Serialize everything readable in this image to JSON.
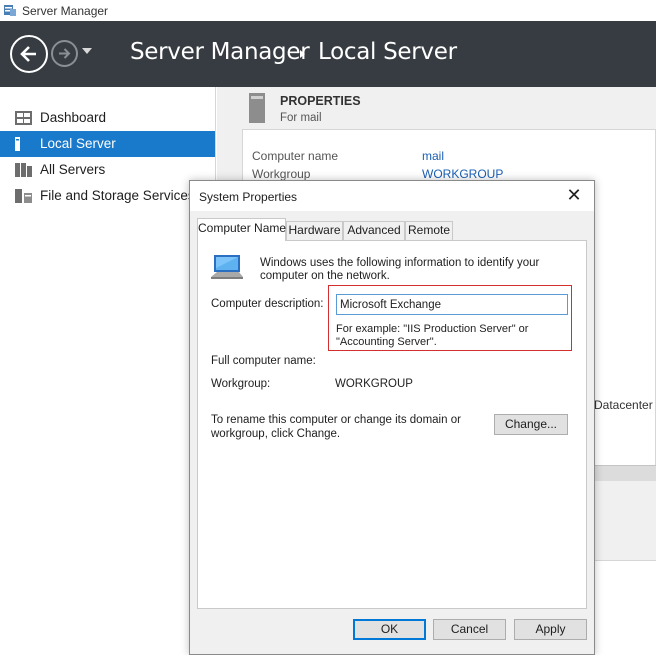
{
  "window": {
    "title": "Server Manager"
  },
  "header": {
    "breadcrumb": [
      "Server Manager",
      "Local Server"
    ]
  },
  "sidebar": {
    "items": [
      {
        "label": "Dashboard",
        "icon": "dashboard-icon",
        "active": false
      },
      {
        "label": "Local Server",
        "icon": "local-server-icon",
        "active": true
      },
      {
        "label": "All Servers",
        "icon": "all-servers-icon",
        "active": false
      },
      {
        "label": "File and Storage Services",
        "icon": "file-storage-icon",
        "active": false
      }
    ]
  },
  "properties": {
    "title": "PROPERTIES",
    "subtitle": "For mail",
    "rows": [
      {
        "label": "Computer name",
        "value": "mail"
      },
      {
        "label": "Workgroup",
        "value": "WORKGROUP"
      }
    ],
    "edition_fragment": "Datacenter"
  },
  "dialog": {
    "title": "System Properties",
    "close_glyph": "✕",
    "tabs": [
      "Computer Name",
      "Hardware",
      "Advanced",
      "Remote"
    ],
    "active_tab": "Computer Name",
    "intro": "Windows uses the following information to identify your computer on the network.",
    "description_label": "Computer description:",
    "description_value": "Microsoft Exchange",
    "example": "For example: \"IIS Production Server\" or \"Accounting Server\".",
    "full_name_label": "Full computer name:",
    "full_name_value": "",
    "workgroup_label": "Workgroup:",
    "workgroup_value": "WORKGROUP",
    "rename_text": "To rename this computer or change its domain or workgroup, click Change.",
    "change_button": "Change...",
    "ok_button": "OK",
    "cancel_button": "Cancel",
    "apply_button": "Apply"
  },
  "colors": {
    "header_bg": "#363c42",
    "active_nav": "#1979ca",
    "highlight_border": "#d32f2f",
    "link": "#1a5fb4"
  }
}
